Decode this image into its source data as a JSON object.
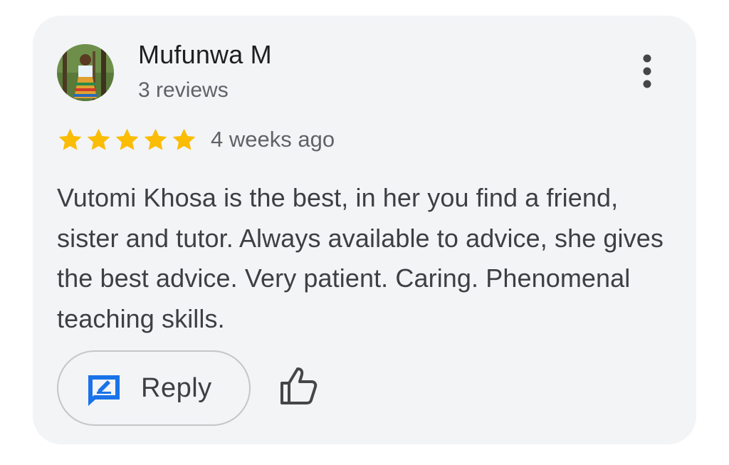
{
  "review": {
    "reviewer_name": "Mufunwa M",
    "reviewer_meta": "3 reviews",
    "rating": 5,
    "rating_max": 5,
    "time_ago": "4 weeks ago",
    "text": "Vutomi Khosa is the best, in her you find a friend, sister and tutor. Always available to advice, she gives the best advice. Very patient. Caring. Phenomenal teaching skills."
  },
  "actions": {
    "reply_label": "Reply",
    "reply_icon": "reply-edit-icon",
    "like_icon": "thumbs-up-icon",
    "more_icon": "more-vert-icon"
  },
  "colors": {
    "card_background": "#f3f4f6",
    "star": "#fbbc04",
    "reply_icon": "#1a73e8",
    "primary_text": "#1f1f1f",
    "secondary_text": "#5f6368",
    "body_text": "#3c4043"
  }
}
